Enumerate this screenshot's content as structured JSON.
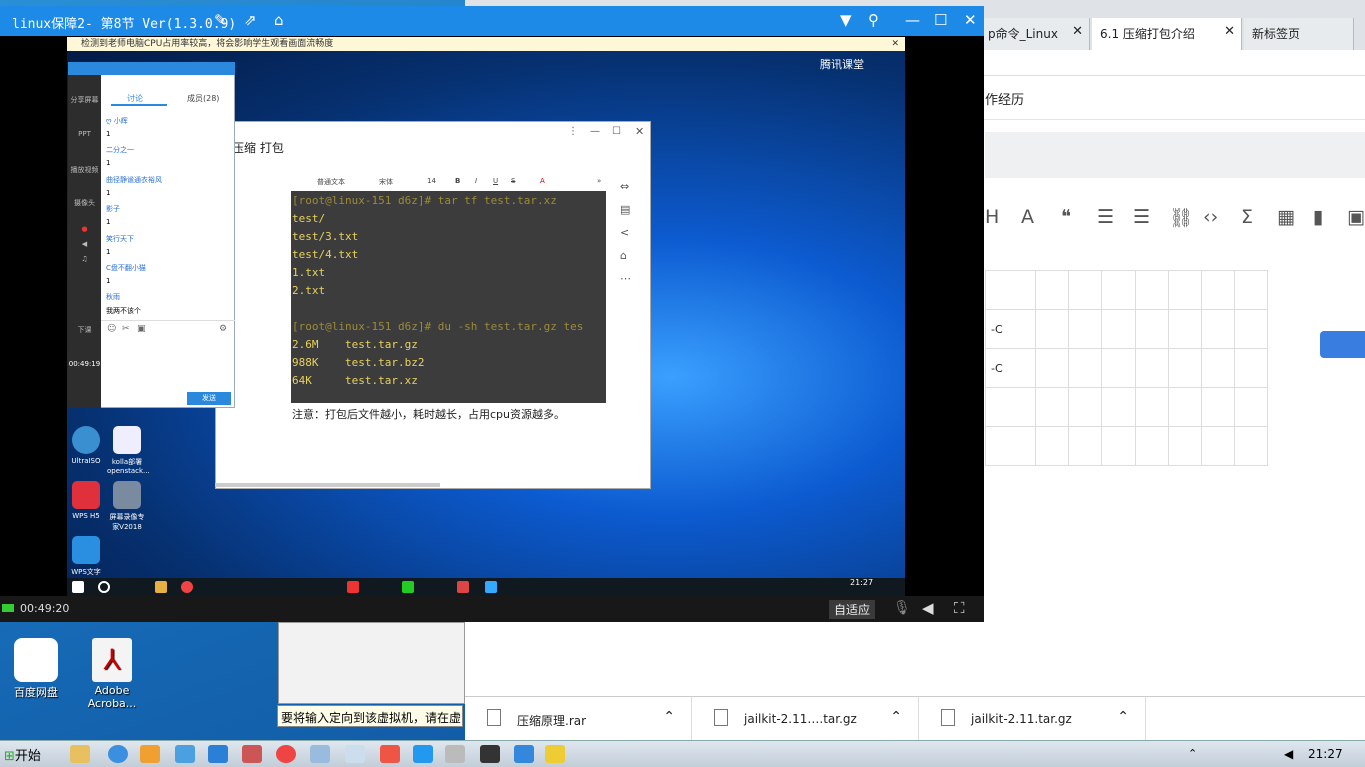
{
  "browser": {
    "tabs": [
      {
        "label": "p命令_Linux"
      },
      {
        "label": "6.1 压缩打包介绍"
      },
      {
        "label": "新标签页"
      }
    ],
    "breadcrumb": "作经历",
    "table_cells": [
      "-C",
      "-C"
    ]
  },
  "downloads": [
    {
      "name": "压缩原理.rar"
    },
    {
      "name": "jailkit-2.11….tar.gz"
    },
    {
      "name": "jailkit-2.11.tar.gz"
    }
  ],
  "vm_tooltip": "要将输入定向到该虚拟机，请在虚",
  "player": {
    "title": "linux保障2- 第8节 Ver(1.3.0.9)",
    "notice": "检测到老师电脑CPU占用率较高，将会影响学生观看画面流畅度",
    "brand": "腾讯课堂",
    "time": "00:49:20",
    "fit_label": "自适应",
    "remote_clock": "21:27"
  },
  "chat": {
    "tab_discuss": "讨论",
    "tab_members": "成员(28)",
    "messages": [
      {
        "name": "ღ 小辉",
        "value": "1"
      },
      {
        "name": "二分之一",
        "value": "1"
      },
      {
        "name": "曲径静谧通衣裕风",
        "value": "1"
      },
      {
        "name": "影子",
        "value": "1"
      },
      {
        "name": "笑行天下",
        "value": "1"
      },
      {
        "name": "C盘不翻小猫",
        "value": "1"
      },
      {
        "name": "秋雨",
        "value": "我两不该个"
      }
    ],
    "send_label": "发送",
    "left_time": "00:49:19",
    "left_items": [
      "分享屏幕",
      "PPT",
      "播放视频",
      "摄像头",
      "下课"
    ]
  },
  "remote_icons": [
    {
      "label": "UltraISO"
    },
    {
      "label": "kolla部署openstack..."
    },
    {
      "label": "WPS H5"
    },
    {
      "label": "屏幕录像专家V2018"
    },
    {
      "label": "WPS文字"
    }
  ],
  "editor": {
    "title": "压缩 打包",
    "toolbar": [
      "普通文本",
      "宋体",
      "14",
      "B",
      "I",
      "U",
      "S",
      "A",
      "»"
    ],
    "terminal": [
      "[root@linux-151 d6z]# tar tf test.tar.xz",
      "test/",
      "test/3.txt",
      "test/4.txt",
      "1.txt",
      "2.txt",
      "",
      "[root@linux-151 d6z]# du -sh test.tar.gz tes",
      "2.6M    test.tar.gz",
      "988K    test.tar.bz2",
      "64K     test.tar.xz"
    ],
    "note": "注意：打包后文件越小，耗时越长，占用cpu资源越多。"
  },
  "host_icons": [
    {
      "label": "百度网盘"
    },
    {
      "label": "Adobe Acroba..."
    }
  ],
  "taskbar": {
    "start_label": "开始",
    "clock": "21:27"
  }
}
